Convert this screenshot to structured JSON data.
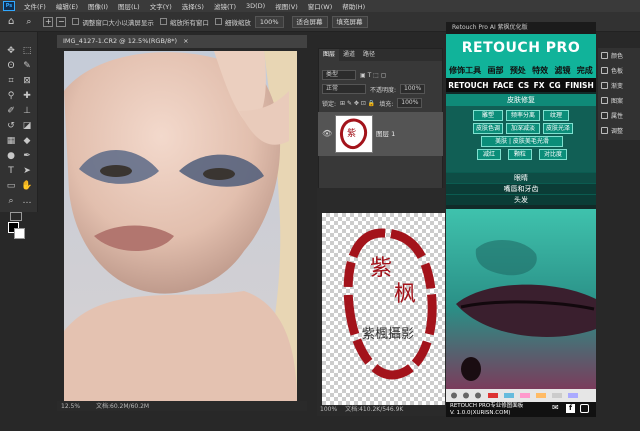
{
  "menu": [
    "文件(F)",
    "编辑(E)",
    "图像(I)",
    "图层(L)",
    "文字(Y)",
    "选择(S)",
    "滤镜(T)",
    "3D(D)",
    "视图(V)",
    "窗口(W)",
    "帮助(H)"
  ],
  "options": {
    "cb1": "调整窗口大小以满屏显示",
    "cb2": "缩放所有窗口",
    "cb3": "细微缩放",
    "zoom": "100%",
    "fit": "适合屏幕",
    "fill": "填充屏幕"
  },
  "doc1": {
    "tab": "IMG_4127-1.CR2 @ 12.5%(RGB/8*)",
    "zoom": "12.5%",
    "info": "文档:60.2M/60.2M"
  },
  "layers": {
    "tabs": [
      "图层",
      "通道",
      "路径"
    ],
    "kind": "类型",
    "mode": "正常",
    "opacity_label": "不透明度:",
    "opacity": "100%",
    "lock_label": "锁定:",
    "fill_label": "填充:",
    "fill": "100%",
    "layer_name": "图层 1",
    "footer": "fx"
  },
  "doc2": {
    "zoom": "100%",
    "info": "文档:410.2K/546.9K",
    "stamp_text": "紫楓攝影"
  },
  "plugin": {
    "header": "Retouch Pro AI 紫枫优化版",
    "logo": "RETOUCH PRO",
    "categories": [
      "修饰工具",
      "画部",
      "预处",
      "特效",
      "滤镜",
      "完成"
    ],
    "tabs": [
      "RETOUCH",
      "FACE",
      "CS",
      "FX",
      "CG",
      "FINISH"
    ],
    "section_skin": "皮肤修复",
    "row1": [
      "雕塑",
      "频率分离",
      "纹理"
    ],
    "row2": [
      "皮肤色调",
      "加深减淡",
      "皮肤光泽"
    ],
    "row3": "美肤 | 皮肤美毛光滑",
    "row4": [
      "减红",
      "颗粒",
      "对比度"
    ],
    "bar1": "眼睛",
    "bar2": "嘴唇和牙齿",
    "bar3": "头发",
    "footer1": "RETOUCH PRO专业修图面板",
    "footer2": "V. 1.0.0(XURISN.COM)"
  },
  "right_panel": [
    "颜色",
    "色板",
    "渐变",
    "图案",
    "属性",
    "调整"
  ]
}
